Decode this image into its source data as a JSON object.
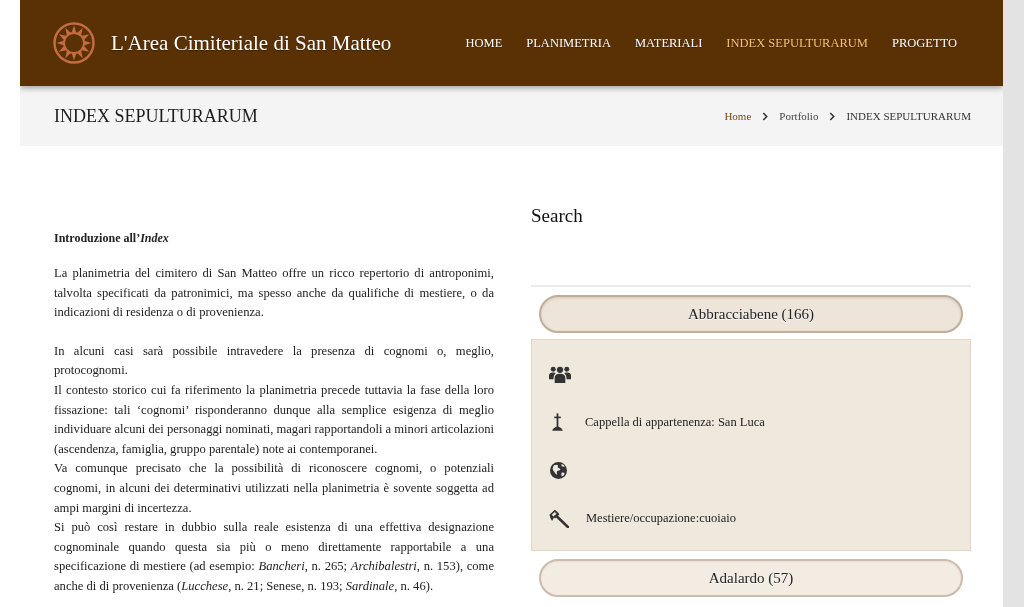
{
  "header": {
    "site_title": "L'Area Cimiteriale di San Matteo",
    "nav": [
      {
        "label": "HOME",
        "selected": false
      },
      {
        "label": "PLANIMETRIA",
        "selected": false
      },
      {
        "label": "MATERIALI",
        "selected": false
      },
      {
        "label": "INDEX SEPULTURARUM",
        "selected": true
      },
      {
        "label": "PROGETTO",
        "selected": false
      }
    ]
  },
  "title_bar": {
    "title": "INDEX SEPULTURARUM",
    "breadcrumb": [
      {
        "label": "Home",
        "kind": "link"
      },
      {
        "label": "Portfolio",
        "kind": "text"
      },
      {
        "label": "INDEX SEPULTURARUM",
        "kind": "current"
      }
    ]
  },
  "intro": {
    "heading": "Introduzione all’*Index*",
    "paragraphs": [
      {
        "lines": [
          "La planimetria del cimitero di San Matteo offre un ricco repertorio di antroponimi, talvolta specificati da patronimici, ma spesso anche da qualifiche di mestiere, o da indicazioni di residenza o di provenienza."
        ]
      },
      {
        "lines": [
          "In alcuni casi sarà possibile intravedere la presenza di cognomi o, meglio, protocognomi.",
          "Il contesto storico cui fa riferimento la planimetria precede tuttavia la fase della loro fissazione: tali ‘cognomi’ risponderanno dunque alla semplice esigenza di meglio individuare alcuni dei personaggi nominati, magari rapportandoli a minori articolazioni (ascendenza, famiglia, gruppo parentale) note ai contemporanei.",
          "Va comunque precisato che la possibilità di riconoscere cognomi, o potenziali cognomi, in alcuni dei determinativi utilizzati nella planimetria è sovente soggetta ad ampi margini di incertezza.",
          "Si può così restare in dubbio sulla reale esistenza di una effettiva designazione cognominale quando questa sia più o meno direttamente rapportabile a una specificazione di mestiere (ad esempio: *Bancheri*, n. 265; *Archibalestri*, n. 153), come anche di di provenienza (*Lucchese*, n. 21; Senese, n. 193; *Sardinale*, n. 46)."
        ]
      }
    ]
  },
  "search": {
    "title": "Search",
    "entries": [
      {
        "label": "Abbracciabene (166)",
        "expanded": true,
        "details": [
          {
            "kind": "people"
          },
          {
            "kind": "chapel",
            "text": "Cappella di appartenenza: San Luca"
          },
          {
            "kind": "origin"
          },
          {
            "kind": "trade",
            "text": "Mestiere/occupazione:cuoiaio"
          }
        ]
      },
      {
        "label": "Adalardo (57)",
        "expanded": false
      }
    ]
  }
}
